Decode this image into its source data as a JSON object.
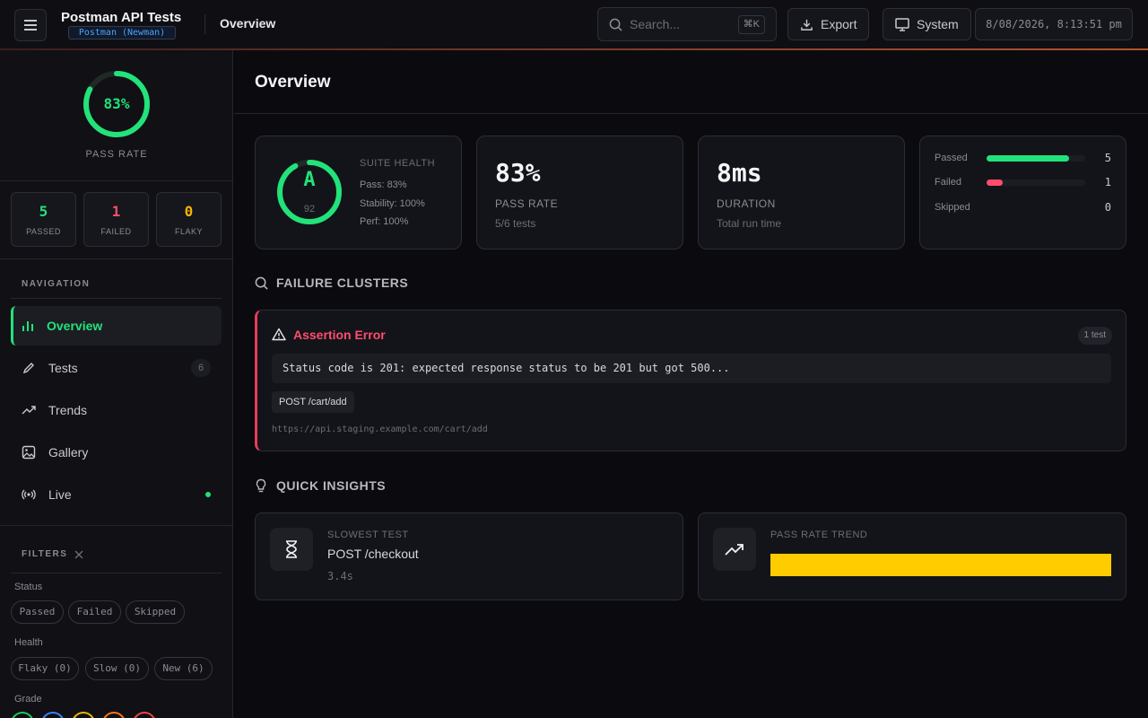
{
  "header": {
    "title": "Postman API Tests",
    "badge": "Postman (Newman)",
    "breadcrumb": "Overview",
    "search_placeholder": "Search...",
    "search_shortcut": "⌘K",
    "export_label": "Export",
    "theme_label": "System",
    "datetime": "8/08/2026, 8:13:51 pm"
  },
  "sidebar": {
    "pass_rate": 83,
    "pass_rate_text": "83%",
    "pass_rate_label": "PASS RATE",
    "stats": [
      {
        "value": "5",
        "label": "PASSED",
        "color": "#22e27a"
      },
      {
        "value": "1",
        "label": "FAILED",
        "color": "#ff4d6d"
      },
      {
        "value": "0",
        "label": "FLAKY",
        "color": "#f5b400"
      }
    ],
    "nav_label": "NAVIGATION",
    "nav": [
      {
        "label": "Overview",
        "icon": "bar-chart-icon",
        "active": true
      },
      {
        "label": "Tests",
        "icon": "pencil-icon",
        "count": "6"
      },
      {
        "label": "Trends",
        "icon": "trending-up-icon"
      },
      {
        "label": "Gallery",
        "icon": "image-icon"
      },
      {
        "label": "Live",
        "icon": "broadcast-icon",
        "live": true
      }
    ],
    "filters_label": "FILTERS",
    "filters": {
      "status_label": "Status",
      "status": [
        "Passed",
        "Failed",
        "Skipped"
      ],
      "health_label": "Health",
      "health": [
        "Flaky (0)",
        "Slow (0)",
        "New (6)"
      ],
      "grade_label": "Grade",
      "grade_colors": [
        "#22c55e",
        "#3b82f6",
        "#eab308",
        "#f97316",
        "#ef4444"
      ]
    }
  },
  "main": {
    "title": "Overview",
    "suite_health": {
      "grade": "A",
      "score": "92",
      "score_value": 92,
      "label": "SUITE HEALTH",
      "pass": "Pass: 83%",
      "stability": "Stability: 100%",
      "perf": "Perf: 100%"
    },
    "pass_rate_card": {
      "value": "83%",
      "label": "PASS RATE",
      "sub": "5/6 tests"
    },
    "duration_card": {
      "value": "8ms",
      "label": "DURATION",
      "sub": "Total run time"
    },
    "breakdown": [
      {
        "label": "Passed",
        "count": "5",
        "fraction": 0.833,
        "color": "#22e27a"
      },
      {
        "label": "Failed",
        "count": "1",
        "fraction": 0.167,
        "color": "#ff4d6d"
      },
      {
        "label": "Skipped",
        "count": "0",
        "fraction": 0,
        "color": "#8a8c94"
      }
    ],
    "failure_clusters": {
      "title": "FAILURE CLUSTERS",
      "error_title": "Assertion Error",
      "count_badge": "1 test",
      "message": "Status code is 201: expected response status to be 201 but got 500...",
      "endpoint": "POST /cart/add",
      "url": "https://api.staging.example.com/cart/add"
    },
    "quick_insights": {
      "title": "QUICK INSIGHTS",
      "slowest_label": "SLOWEST TEST",
      "slowest_name": "POST /checkout",
      "slowest_time": "3.4s",
      "trend_label": "PASS RATE TREND",
      "trend_color": "#ffcc00"
    }
  }
}
